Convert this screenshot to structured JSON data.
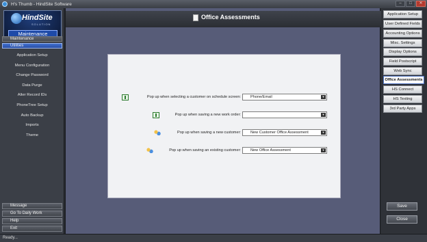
{
  "window": {
    "title": "H's Thumb - HindSite Software"
  },
  "logo": {
    "name": "HindSite",
    "sub": "SOLUTION",
    "mode": "Maintenance"
  },
  "sidebar": {
    "sections": [
      "Maintenance",
      "Utilities"
    ],
    "items": [
      "Application Setup",
      "Menu Configuration",
      "Change Password",
      "Data Purge",
      "Alter Record IDs",
      "PhoneTree Setup",
      "Auto Backup",
      "Imports",
      "Theme"
    ],
    "bottom": [
      "Message",
      "Go To Daily Work",
      "Help",
      "Exit"
    ]
  },
  "main": {
    "title": "Office Assessments",
    "rows": [
      {
        "label": "Pop up when selecting a customer on schedule screen:",
        "value": "Phone/Email",
        "icon": "calendar-icon"
      },
      {
        "label": "Pop up when saving a new work order:",
        "value": "",
        "icon": "calendar-icon"
      },
      {
        "label": "Pop up when saving a new customer:",
        "value": "New Customer Office Assessment",
        "icon": "people-icon"
      },
      {
        "label": "Pop up when saving an existing customer:",
        "value": "New Office Assessment",
        "icon": "people-icon"
      }
    ]
  },
  "tabs": [
    "Application Setup",
    "User Defined Fields",
    "Accounting Options",
    "Misc. Settings",
    "Display Options",
    "Field Postscript",
    "Web Sync",
    "Office Assessments",
    "HS Connect",
    "HS Texting",
    "3rd Party Apps"
  ],
  "active_tab": "Office Assessments",
  "actions": {
    "save": "Save",
    "close": "Close"
  },
  "status": "Ready..."
}
